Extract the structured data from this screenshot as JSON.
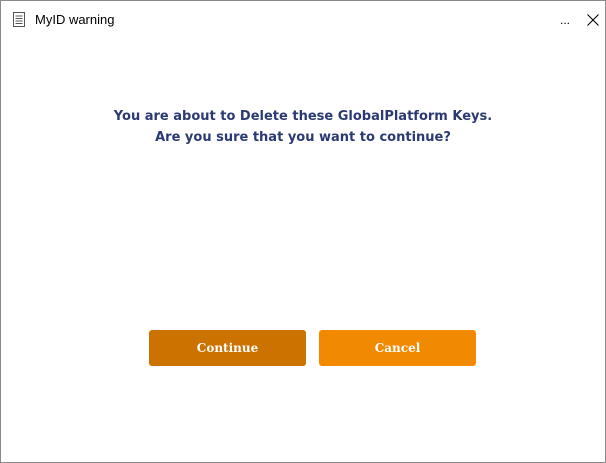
{
  "window": {
    "title": "MyID warning",
    "title_icon": "document-icon",
    "more_label": "...",
    "close_icon": "close-icon"
  },
  "dialog": {
    "message_line1": "You are about to Delete these GlobalPlatform Keys.",
    "message_line2": "Are you sure that you want to continue?",
    "message_color": "#2b3a72"
  },
  "buttons": {
    "continue_label": "Continue",
    "continue_color": "#cc7200",
    "cancel_label": "Cancel",
    "cancel_color": "#f18a00"
  }
}
